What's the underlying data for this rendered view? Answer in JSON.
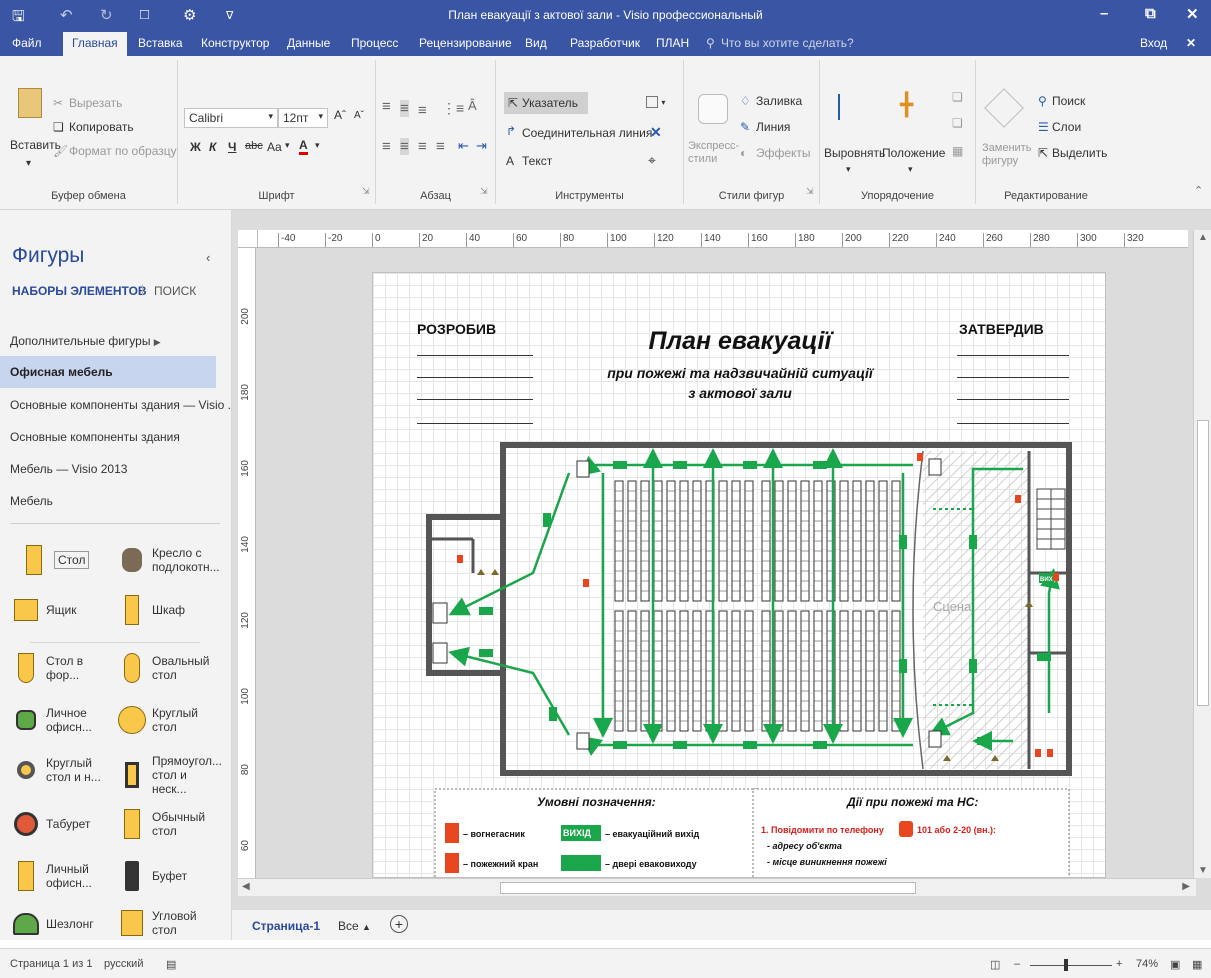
{
  "title_bar": {
    "window_title": "План евакуації з актової зали - Visio профессиональный",
    "icons": [
      "save-icon",
      "undo-icon",
      "redo-icon",
      "new-icon",
      "customize-icon",
      "quick-access-dropdown-icon"
    ],
    "window_buttons": [
      "minimize-icon",
      "restore-icon",
      "close-icon"
    ]
  },
  "menu": {
    "tabs": [
      "Файл",
      "Главная",
      "Вставка",
      "Конструктор",
      "Данные",
      "Процесс",
      "Рецензирование",
      "Вид",
      "Разработчик",
      "ПЛАН"
    ],
    "active_tab": "Главная",
    "tell_me": "Что вы хотите сделать?",
    "sign_in": "Вход"
  },
  "ribbon": {
    "clipboard": {
      "paste": "Вставить",
      "cut": "Вырезать",
      "copy": "Копировать",
      "format_painter": "Формат по образцу",
      "label": "Буфер обмена"
    },
    "font": {
      "family": "Calibri",
      "size": "12пт",
      "bold": "Ж",
      "italic": "К",
      "underline": "Ч",
      "strike": "abc",
      "case": "Aa",
      "color": "A",
      "label": "Шрифт"
    },
    "paragraph": {
      "label": "Абзац"
    },
    "tools": {
      "pointer": "Указатель",
      "connector": "Соединительная линия",
      "text": "Текст",
      "label": "Инструменты"
    },
    "shape_styles": {
      "express": "Экспресс-стили",
      "fill": "Заливка",
      "line": "Линия",
      "effects": "Эффекты",
      "label": "Стили фигур"
    },
    "arrange": {
      "align": "Выровнять",
      "position": "Положение",
      "label": "Упорядочение"
    },
    "editing": {
      "replace": "Заменить фигуру",
      "find": "Поиск",
      "layers": "Слои",
      "select": "Выделить",
      "label": "Редактирование"
    }
  },
  "shapes_panel": {
    "title": "Фигуры",
    "tab_sets": "НАБОРЫ ЭЛЕМЕНТОВ",
    "tab_search": "ПОИСК",
    "sets": [
      "Дополнительные фигуры",
      "Офисная мебель",
      "Основные компоненты здания — Visio ...",
      "Основные компоненты здания",
      "Мебель — Visio 2013",
      "Мебель"
    ],
    "selected_set": "Офисная мебель",
    "shapes": [
      {
        "label": "Стол",
        "icon": "desk-icon"
      },
      {
        "label": "Кресло с подлокотн...",
        "icon": "armchair-icon"
      },
      {
        "label": "Ящик",
        "icon": "box-icon"
      },
      {
        "label": "Шкаф",
        "icon": "cabinet-icon"
      },
      {
        "label": "Стол в фор...",
        "icon": "shaped-desk-icon"
      },
      {
        "label": "Овальный стол",
        "icon": "oval-table-icon"
      },
      {
        "label": "Личное офисн...",
        "icon": "office-chair-icon"
      },
      {
        "label": "Круглый стол",
        "icon": "round-table-icon"
      },
      {
        "label": "Круглый стол и н...",
        "icon": "round-table-chairs-icon"
      },
      {
        "label": "Прямоугол... стол и неск...",
        "icon": "rect-table-chairs-icon"
      },
      {
        "label": "Табурет",
        "icon": "stool-icon"
      },
      {
        "label": "Обычный стол",
        "icon": "plain-table-icon"
      },
      {
        "label": "Личный офисн...",
        "icon": "personal-office-icon"
      },
      {
        "label": "Буфет",
        "icon": "buffet-icon"
      },
      {
        "label": "Шезлонг",
        "icon": "lounge-icon"
      },
      {
        "label": "Угловой стол",
        "icon": "corner-table-icon"
      }
    ]
  },
  "ruler": {
    "h_ticks": [
      "-40",
      "-20",
      "0",
      "20",
      "40",
      "60",
      "80",
      "100",
      "120",
      "140",
      "160",
      "180",
      "200",
      "220",
      "240",
      "260",
      "280",
      "300",
      "320"
    ],
    "v_ticks": [
      "200",
      "180",
      "160",
      "140",
      "120",
      "100",
      "80",
      "60"
    ]
  },
  "drawing": {
    "developed": "РОЗРОБИВ",
    "approved": "ЗАТВЕРДИВ",
    "title": "План евакуації",
    "subtitle1": "при пожежі та надзвичайній ситуації",
    "subtitle2": "з актової зали",
    "stage": "Сцена",
    "exit_sign": "ВИХІД",
    "legend_title": "Умовні позначення:",
    "legend": [
      "– вогнегасник",
      "– пожежний кран",
      "– евакуаційний вихід",
      "– двері евакoвиходу"
    ],
    "actions_title": "Дії при пожежі та НС:",
    "actions_line1": "1. Повідомити по телефону",
    "actions_phone": "101 або 2-20 (вн.):",
    "actions_items": [
      "- адресу об'єкта",
      "- місце виникнення пожежі"
    ],
    "colors": {
      "arrow": "#1aa64a",
      "exit": "#1aa64a",
      "extinguisher": "#e8461e",
      "wall": "#555555"
    }
  },
  "page_tabs": {
    "current": "Страница-1",
    "all": "Все"
  },
  "status": {
    "page": "Страница 1 из 1",
    "language": "русский",
    "zoom": "74%"
  }
}
